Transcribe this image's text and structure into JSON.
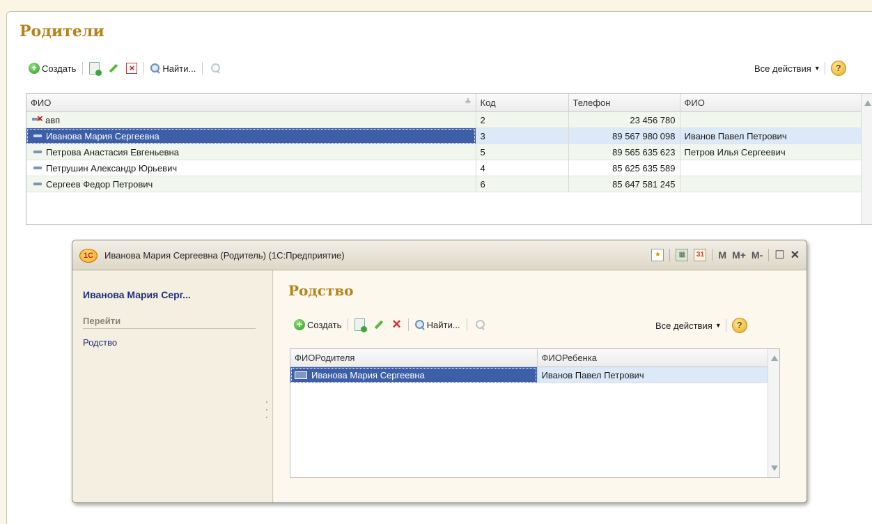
{
  "page": {
    "title": "Родители",
    "toolbar": {
      "create_label": "Создать",
      "find_label": "Найти...",
      "all_actions_label": "Все действия",
      "help_label": "?"
    },
    "table": {
      "columns": [
        "ФИО",
        "Код",
        "Телефон",
        "ФИО"
      ],
      "rows": [
        {
          "fio": "авп",
          "code": "2",
          "phone": "23 456 780",
          "fio2": "",
          "marked_deleted": true
        },
        {
          "fio": "Иванова Мария Сергеевна",
          "code": "3",
          "phone": "89 567 980 098",
          "fio2": "Иванов Павел Петрович",
          "selected": true
        },
        {
          "fio": "Петрова Анастасия Евгеньевна",
          "code": "5",
          "phone": "89 565 635 623",
          "fio2": "Петров Илья Сергеевич"
        },
        {
          "fio": "Петрушин Александр Юрьевич",
          "code": "4",
          "phone": "85 625 635 589",
          "fio2": ""
        },
        {
          "fio": "Сергеев Федор Петрович",
          "code": "6",
          "phone": "85 647 581 245",
          "fio2": ""
        }
      ]
    }
  },
  "child_window": {
    "title": "Иванова Мария Сергеевна (Родитель) (1С:Предприятие)",
    "logo_text": "1С",
    "toolbar_icons": {
      "m": "M",
      "m_plus": "M+",
      "m_minus": "M-"
    },
    "side": {
      "title": "Иванова Мария Серг...",
      "goto_label": "Перейти",
      "link": "Родство"
    },
    "content": {
      "title": "Родство",
      "toolbar": {
        "create_label": "Создать",
        "find_label": "Найти...",
        "all_actions_label": "Все действия",
        "help_label": "?"
      },
      "table": {
        "columns": [
          "ФИОРодителя",
          "ФИОРебенка"
        ],
        "rows": [
          {
            "parent": "Иванова Мария Сергеевна",
            "child": "Иванов Павел Петрович",
            "selected": true
          }
        ]
      }
    }
  },
  "colors": {
    "title_accent": "#b5811a",
    "selection": "#3d5fa8",
    "selected_row": "#dce9f8",
    "alt_row": "#f2f7ee"
  }
}
